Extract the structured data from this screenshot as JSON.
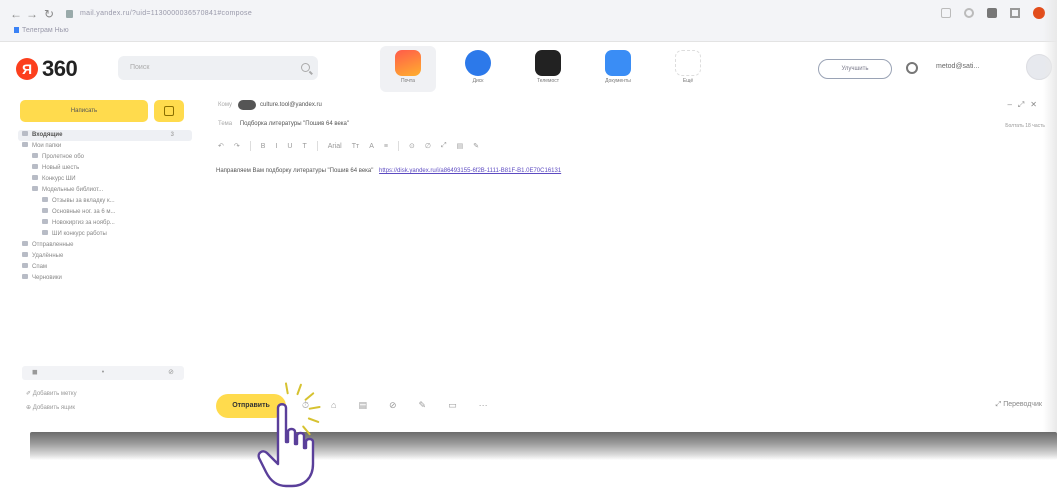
{
  "browser": {
    "address": "mail.yandex.ru/?uid=1130000036570841#compose",
    "bookmark": "Телеграм Нью"
  },
  "app": {
    "logo_text": "360",
    "logo_ya": "Я",
    "search_placeholder": "Поиск",
    "services": [
      {
        "label": "Почта",
        "icon": "mail-icon",
        "active": true
      },
      {
        "label": "Диск",
        "icon": "disk-icon",
        "active": false
      },
      {
        "label": "Телемост",
        "icon": "telemost-icon",
        "active": false
      },
      {
        "label": "Документы",
        "icon": "docs-icon",
        "active": false
      },
      {
        "label": "Ещё",
        "icon": "more-icon",
        "active": false
      }
    ],
    "upgrade_label": "Улучшить",
    "account": "metod@sati..."
  },
  "sidebar": {
    "compose_label": "Написать",
    "folders": [
      {
        "label": "Входящие",
        "count": "3",
        "cls": "inbox"
      },
      {
        "label": "Мои папки",
        "count": "",
        "cls": ""
      },
      {
        "label": "Пролетное обо",
        "count": "",
        "cls": "sub"
      },
      {
        "label": "Новый шесть",
        "count": "",
        "cls": "sub"
      },
      {
        "label": "Конкурс ШИ",
        "count": "",
        "cls": "sub"
      },
      {
        "label": "Модельные библиот...",
        "count": "",
        "cls": "sub"
      },
      {
        "label": "Отзывы за вкладку к...",
        "count": "",
        "cls": "sub2"
      },
      {
        "label": "Основные ног. за 6 м...",
        "count": "",
        "cls": "sub2"
      },
      {
        "label": "Новокиргиз за ноябр...",
        "count": "",
        "cls": "sub2"
      },
      {
        "label": "ШИ конкурс работы",
        "count": "",
        "cls": "sub2"
      },
      {
        "label": "Отправленные",
        "count": "",
        "cls": ""
      },
      {
        "label": "Удалённые",
        "count": "",
        "cls": ""
      },
      {
        "label": "Спам",
        "count": "",
        "cls": ""
      },
      {
        "label": "Черновики",
        "count": "",
        "cls": ""
      }
    ],
    "tools": [
      "◼",
      "•",
      "⊘"
    ],
    "add_label": "Добавить метку",
    "add_folder": "Добавить ящик"
  },
  "compose": {
    "to_label": "Кому",
    "to_value": "culture.tool@yandex.ru",
    "subject_label": "Тема",
    "subject_value": "Подборка литературы \"Пошив 64 века\"",
    "sender": "Болтать 18 часть",
    "toolbar": [
      "↶",
      "↷",
      "B",
      "I",
      "U",
      "T",
      "Arial",
      "Тт",
      "A",
      "≡",
      "⊙",
      "∅",
      "⤢",
      "▤",
      "✎"
    ],
    "body_text": "Направляем Вам подборку литературы \"Пошив 64 века\"",
    "body_link": "https://disk.yandex.ru/i/a86493155-6f2B-1111-B81F-B1.0E70C16131",
    "send_label": "Отправить",
    "bottom_tools": [
      "⏱",
      "⌂",
      "▤",
      "⊘",
      "✎",
      "▭",
      "···"
    ],
    "translate_label": "Переводчик"
  },
  "colors": {
    "accent_yellow": "#ffdb4d",
    "brand_red": "#fc3f1d",
    "link": "#5d4bc2"
  }
}
